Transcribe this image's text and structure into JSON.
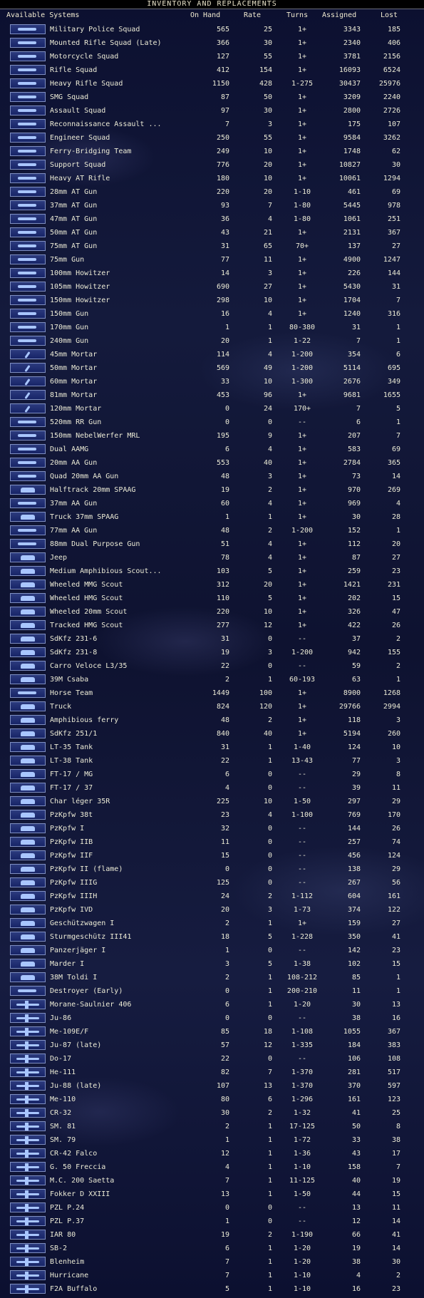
{
  "window": {
    "title": "INVENTORY AND REPLACEMENTS"
  },
  "columns": {
    "name": "Available Systems",
    "on_hand": "On Hand",
    "rate": "Rate",
    "turns": "Turns",
    "assigned": "Assigned",
    "lost": "Lost"
  },
  "systems": [
    {
      "name": "Military Police Squad",
      "on_hand": "565",
      "rate": "25",
      "turns": "1+",
      "assigned": "3343",
      "lost": "185",
      "icon": "infantry-icon"
    },
    {
      "name": "Mounted Rifle Squad (Late)",
      "on_hand": "366",
      "rate": "30",
      "turns": "1+",
      "assigned": "2340",
      "lost": "406",
      "icon": "infantry-icon"
    },
    {
      "name": "Motorcycle Squad",
      "on_hand": "127",
      "rate": "55",
      "turns": "1+",
      "assigned": "3781",
      "lost": "2156",
      "icon": "infantry-icon"
    },
    {
      "name": "Rifle Squad",
      "on_hand": "412",
      "rate": "154",
      "turns": "1+",
      "assigned": "16093",
      "lost": "6524",
      "icon": "infantry-icon"
    },
    {
      "name": "Heavy Rifle Squad",
      "on_hand": "1150",
      "rate": "428",
      "turns": "1-275",
      "assigned": "30437",
      "lost": "25976",
      "icon": "infantry-icon"
    },
    {
      "name": "SMG Squad",
      "on_hand": "87",
      "rate": "50",
      "turns": "1+",
      "assigned": "3209",
      "lost": "2240",
      "icon": "infantry-icon"
    },
    {
      "name": "Assault Squad",
      "on_hand": "97",
      "rate": "30",
      "turns": "1+",
      "assigned": "2800",
      "lost": "2726",
      "icon": "infantry-icon"
    },
    {
      "name": "Reconnaissance Assault ...",
      "on_hand": "7",
      "rate": "3",
      "turns": "1+",
      "assigned": "175",
      "lost": "107",
      "icon": "infantry-icon"
    },
    {
      "name": "Engineer Squad",
      "on_hand": "250",
      "rate": "55",
      "turns": "1+",
      "assigned": "9584",
      "lost": "3262",
      "icon": "infantry-icon"
    },
    {
      "name": "Ferry-Bridging Team",
      "on_hand": "249",
      "rate": "10",
      "turns": "1+",
      "assigned": "1748",
      "lost": "62",
      "icon": "infantry-icon"
    },
    {
      "name": "Support Squad",
      "on_hand": "776",
      "rate": "20",
      "turns": "1+",
      "assigned": "10827",
      "lost": "30",
      "icon": "infantry-icon"
    },
    {
      "name": "Heavy AT Rifle",
      "on_hand": "180",
      "rate": "10",
      "turns": "1+",
      "assigned": "10061",
      "lost": "1294",
      "icon": "gun-icon"
    },
    {
      "name": "28mm AT Gun",
      "on_hand": "220",
      "rate": "20",
      "turns": "1-10",
      "assigned": "461",
      "lost": "69",
      "icon": "gun-icon"
    },
    {
      "name": "37mm AT Gun",
      "on_hand": "93",
      "rate": "7",
      "turns": "1-80",
      "assigned": "5445",
      "lost": "978",
      "icon": "gun-icon"
    },
    {
      "name": "47mm AT Gun",
      "on_hand": "36",
      "rate": "4",
      "turns": "1-80",
      "assigned": "1061",
      "lost": "251",
      "icon": "gun-icon"
    },
    {
      "name": "50mm AT Gun",
      "on_hand": "43",
      "rate": "21",
      "turns": "1+",
      "assigned": "2131",
      "lost": "367",
      "icon": "gun-icon"
    },
    {
      "name": "75mm AT Gun",
      "on_hand": "31",
      "rate": "65",
      "turns": "70+",
      "assigned": "137",
      "lost": "27",
      "icon": "gun-icon"
    },
    {
      "name": "75mm Gun",
      "on_hand": "77",
      "rate": "11",
      "turns": "1+",
      "assigned": "4900",
      "lost": "1247",
      "icon": "gun-icon"
    },
    {
      "name": "100mm Howitzer",
      "on_hand": "14",
      "rate": "3",
      "turns": "1+",
      "assigned": "226",
      "lost": "144",
      "icon": "gun-icon"
    },
    {
      "name": "105mm Howitzer",
      "on_hand": "690",
      "rate": "27",
      "turns": "1+",
      "assigned": "5430",
      "lost": "31",
      "icon": "gun-icon"
    },
    {
      "name": "150mm Howitzer",
      "on_hand": "298",
      "rate": "10",
      "turns": "1+",
      "assigned": "1704",
      "lost": "7",
      "icon": "gun-icon"
    },
    {
      "name": "150mm Gun",
      "on_hand": "16",
      "rate": "4",
      "turns": "1+",
      "assigned": "1240",
      "lost": "316",
      "icon": "gun-icon"
    },
    {
      "name": "170mm Gun",
      "on_hand": "1",
      "rate": "1",
      "turns": "80-380",
      "assigned": "31",
      "lost": "1",
      "icon": "gun-icon"
    },
    {
      "name": "240mm Gun",
      "on_hand": "20",
      "rate": "1",
      "turns": "1-22",
      "assigned": "7",
      "lost": "1",
      "icon": "gun-icon"
    },
    {
      "name": "45mm Mortar",
      "on_hand": "114",
      "rate": "4",
      "turns": "1-200",
      "assigned": "354",
      "lost": "6",
      "icon": "mortar-icon"
    },
    {
      "name": "50mm Mortar",
      "on_hand": "569",
      "rate": "49",
      "turns": "1-200",
      "assigned": "5114",
      "lost": "695",
      "icon": "mortar-icon"
    },
    {
      "name": "60mm Mortar",
      "on_hand": "33",
      "rate": "10",
      "turns": "1-300",
      "assigned": "2676",
      "lost": "349",
      "icon": "mortar-icon"
    },
    {
      "name": "81mm Mortar",
      "on_hand": "453",
      "rate": "96",
      "turns": "1+",
      "assigned": "9681",
      "lost": "1655",
      "icon": "mortar-icon"
    },
    {
      "name": "120mm Mortar",
      "on_hand": "0",
      "rate": "24",
      "turns": "170+",
      "assigned": "7",
      "lost": "5",
      "icon": "mortar-icon"
    },
    {
      "name": "520mm RR Gun",
      "on_hand": "0",
      "rate": "0",
      "turns": "--",
      "assigned": "6",
      "lost": "1",
      "icon": "gun-icon"
    },
    {
      "name": "150mm NebelWerfer MRL",
      "on_hand": "195",
      "rate": "9",
      "turns": "1+",
      "assigned": "207",
      "lost": "7",
      "icon": "gun-icon"
    },
    {
      "name": "Dual AAMG",
      "on_hand": "6",
      "rate": "4",
      "turns": "1+",
      "assigned": "583",
      "lost": "69",
      "icon": "gun-icon"
    },
    {
      "name": "20mm AA Gun",
      "on_hand": "553",
      "rate": "40",
      "turns": "1+",
      "assigned": "2784",
      "lost": "365",
      "icon": "gun-icon"
    },
    {
      "name": "Quad 20mm AA Gun",
      "on_hand": "48",
      "rate": "3",
      "turns": "1+",
      "assigned": "73",
      "lost": "14",
      "icon": "gun-icon"
    },
    {
      "name": "Halftrack 20mm SPAAG",
      "on_hand": "19",
      "rate": "2",
      "turns": "1+",
      "assigned": "970",
      "lost": "269",
      "icon": "vehicle-icon"
    },
    {
      "name": "37mm AA Gun",
      "on_hand": "60",
      "rate": "4",
      "turns": "1+",
      "assigned": "969",
      "lost": "4",
      "icon": "gun-icon"
    },
    {
      "name": "Truck 37mm SPAAG",
      "on_hand": "1",
      "rate": "1",
      "turns": "1+",
      "assigned": "30",
      "lost": "28",
      "icon": "vehicle-icon"
    },
    {
      "name": "77mm AA Gun",
      "on_hand": "48",
      "rate": "2",
      "turns": "1-200",
      "assigned": "152",
      "lost": "1",
      "icon": "gun-icon"
    },
    {
      "name": "88mm Dual Purpose Gun",
      "on_hand": "51",
      "rate": "4",
      "turns": "1+",
      "assigned": "112",
      "lost": "20",
      "icon": "gun-icon"
    },
    {
      "name": "Jeep",
      "on_hand": "78",
      "rate": "4",
      "turns": "1+",
      "assigned": "87",
      "lost": "27",
      "icon": "vehicle-icon"
    },
    {
      "name": "Medium Amphibious Scout...",
      "on_hand": "103",
      "rate": "5",
      "turns": "1+",
      "assigned": "259",
      "lost": "23",
      "icon": "vehicle-icon"
    },
    {
      "name": "Wheeled MMG Scout",
      "on_hand": "312",
      "rate": "20",
      "turns": "1+",
      "assigned": "1421",
      "lost": "231",
      "icon": "vehicle-icon"
    },
    {
      "name": "Wheeled HMG Scout",
      "on_hand": "110",
      "rate": "5",
      "turns": "1+",
      "assigned": "202",
      "lost": "15",
      "icon": "vehicle-icon"
    },
    {
      "name": "Wheeled 20mm Scout",
      "on_hand": "220",
      "rate": "10",
      "turns": "1+",
      "assigned": "326",
      "lost": "47",
      "icon": "vehicle-icon"
    },
    {
      "name": "Tracked HMG Scout",
      "on_hand": "277",
      "rate": "12",
      "turns": "1+",
      "assigned": "422",
      "lost": "26",
      "icon": "vehicle-icon"
    },
    {
      "name": "SdKfz 231-6",
      "on_hand": "31",
      "rate": "0",
      "turns": "--",
      "assigned": "37",
      "lost": "2",
      "icon": "vehicle-icon"
    },
    {
      "name": "SdKfz 231-8",
      "on_hand": "19",
      "rate": "3",
      "turns": "1-200",
      "assigned": "942",
      "lost": "155",
      "icon": "vehicle-icon"
    },
    {
      "name": "Carro Veloce L3/35",
      "on_hand": "22",
      "rate": "0",
      "turns": "--",
      "assigned": "59",
      "lost": "2",
      "icon": "tank-icon"
    },
    {
      "name": "39M Csaba",
      "on_hand": "2",
      "rate": "1",
      "turns": "60-193",
      "assigned": "63",
      "lost": "1",
      "icon": "vehicle-icon"
    },
    {
      "name": "Horse Team",
      "on_hand": "1449",
      "rate": "100",
      "turns": "1+",
      "assigned": "8900",
      "lost": "1268",
      "icon": "horse-icon"
    },
    {
      "name": "Truck",
      "on_hand": "824",
      "rate": "120",
      "turns": "1+",
      "assigned": "29766",
      "lost": "2994",
      "icon": "truck-icon"
    },
    {
      "name": "Amphibious ferry",
      "on_hand": "48",
      "rate": "2",
      "turns": "1+",
      "assigned": "118",
      "lost": "3",
      "icon": "vehicle-icon"
    },
    {
      "name": "SdKfz 251/1",
      "on_hand": "840",
      "rate": "40",
      "turns": "1+",
      "assigned": "5194",
      "lost": "260",
      "icon": "vehicle-icon"
    },
    {
      "name": "LT-35 Tank",
      "on_hand": "31",
      "rate": "1",
      "turns": "1-40",
      "assigned": "124",
      "lost": "10",
      "icon": "tank-icon"
    },
    {
      "name": "LT-38 Tank",
      "on_hand": "22",
      "rate": "1",
      "turns": "13-43",
      "assigned": "77",
      "lost": "3",
      "icon": "tank-icon"
    },
    {
      "name": "FT-17 / MG",
      "on_hand": "6",
      "rate": "0",
      "turns": "--",
      "assigned": "29",
      "lost": "8",
      "icon": "tank-icon"
    },
    {
      "name": "FT-17 / 37",
      "on_hand": "4",
      "rate": "0",
      "turns": "--",
      "assigned": "39",
      "lost": "11",
      "icon": "tank-icon"
    },
    {
      "name": "Char léger 35R",
      "on_hand": "225",
      "rate": "10",
      "turns": "1-50",
      "assigned": "297",
      "lost": "29",
      "icon": "tank-icon"
    },
    {
      "name": "PzKpfw 38t",
      "on_hand": "23",
      "rate": "4",
      "turns": "1-100",
      "assigned": "769",
      "lost": "170",
      "icon": "tank-icon"
    },
    {
      "name": "PzKpfw I",
      "on_hand": "32",
      "rate": "0",
      "turns": "--",
      "assigned": "144",
      "lost": "26",
      "icon": "tank-icon"
    },
    {
      "name": "PzKpfw IIB",
      "on_hand": "11",
      "rate": "0",
      "turns": "--",
      "assigned": "257",
      "lost": "74",
      "icon": "tank-icon"
    },
    {
      "name": "PzKpfw IIF",
      "on_hand": "15",
      "rate": "0",
      "turns": "--",
      "assigned": "456",
      "lost": "124",
      "icon": "tank-icon"
    },
    {
      "name": "PzKpfw II (flame)",
      "on_hand": "0",
      "rate": "0",
      "turns": "--",
      "assigned": "138",
      "lost": "29",
      "icon": "tank-icon"
    },
    {
      "name": "PzKpfw IIIG",
      "on_hand": "125",
      "rate": "0",
      "turns": "--",
      "assigned": "267",
      "lost": "56",
      "icon": "tank-icon"
    },
    {
      "name": "PzKpfw IIIH",
      "on_hand": "24",
      "rate": "2",
      "turns": "1-112",
      "assigned": "604",
      "lost": "161",
      "icon": "tank-icon"
    },
    {
      "name": "PzKpfw IVD",
      "on_hand": "20",
      "rate": "3",
      "turns": "1-73",
      "assigned": "374",
      "lost": "122",
      "icon": "tank-icon"
    },
    {
      "name": "Geschützwagen I",
      "on_hand": "2",
      "rate": "1",
      "turns": "1+",
      "assigned": "159",
      "lost": "27",
      "icon": "tank-icon"
    },
    {
      "name": "Sturmgeschütz III41",
      "on_hand": "18",
      "rate": "5",
      "turns": "1-228",
      "assigned": "350",
      "lost": "41",
      "icon": "tank-icon"
    },
    {
      "name": "Panzerjäger I",
      "on_hand": "1",
      "rate": "0",
      "turns": "--",
      "assigned": "142",
      "lost": "23",
      "icon": "tank-icon"
    },
    {
      "name": "Marder I",
      "on_hand": "3",
      "rate": "5",
      "turns": "1-38",
      "assigned": "102",
      "lost": "15",
      "icon": "tank-icon"
    },
    {
      "name": "38M Toldi I",
      "on_hand": "2",
      "rate": "1",
      "turns": "108-212",
      "assigned": "85",
      "lost": "1",
      "icon": "tank-icon"
    },
    {
      "name": "Destroyer (Early)",
      "on_hand": "0",
      "rate": "1",
      "turns": "200-210",
      "assigned": "11",
      "lost": "1",
      "icon": "ship-icon"
    },
    {
      "name": "Morane-Saulnier 406",
      "on_hand": "6",
      "rate": "1",
      "turns": "1-20",
      "assigned": "30",
      "lost": "13",
      "icon": "plane-icon"
    },
    {
      "name": "Ju-86",
      "on_hand": "0",
      "rate": "0",
      "turns": "--",
      "assigned": "38",
      "lost": "16",
      "icon": "plane-icon"
    },
    {
      "name": "Me-109E/F",
      "on_hand": "85",
      "rate": "18",
      "turns": "1-108",
      "assigned": "1055",
      "lost": "367",
      "icon": "plane-icon"
    },
    {
      "name": "Ju-87 (late)",
      "on_hand": "57",
      "rate": "12",
      "turns": "1-335",
      "assigned": "184",
      "lost": "383",
      "icon": "plane-icon"
    },
    {
      "name": "Do-17",
      "on_hand": "22",
      "rate": "0",
      "turns": "--",
      "assigned": "106",
      "lost": "108",
      "icon": "plane-icon"
    },
    {
      "name": "He-111",
      "on_hand": "82",
      "rate": "7",
      "turns": "1-370",
      "assigned": "281",
      "lost": "517",
      "icon": "plane-icon"
    },
    {
      "name": "Ju-88 (late)",
      "on_hand": "107",
      "rate": "13",
      "turns": "1-370",
      "assigned": "370",
      "lost": "597",
      "icon": "plane-icon"
    },
    {
      "name": "Me-110",
      "on_hand": "80",
      "rate": "6",
      "turns": "1-296",
      "assigned": "161",
      "lost": "123",
      "icon": "plane-icon"
    },
    {
      "name": "CR-32",
      "on_hand": "30",
      "rate": "2",
      "turns": "1-32",
      "assigned": "41",
      "lost": "25",
      "icon": "plane-icon"
    },
    {
      "name": "SM. 81",
      "on_hand": "2",
      "rate": "1",
      "turns": "17-125",
      "assigned": "50",
      "lost": "8",
      "icon": "plane-icon"
    },
    {
      "name": "SM. 79",
      "on_hand": "1",
      "rate": "1",
      "turns": "1-72",
      "assigned": "33",
      "lost": "38",
      "icon": "plane-icon"
    },
    {
      "name": "CR-42 Falco",
      "on_hand": "12",
      "rate": "1",
      "turns": "1-36",
      "assigned": "43",
      "lost": "17",
      "icon": "plane-icon"
    },
    {
      "name": "G. 50 Freccia",
      "on_hand": "4",
      "rate": "1",
      "turns": "1-10",
      "assigned": "158",
      "lost": "7",
      "icon": "plane-icon"
    },
    {
      "name": "M.C. 200 Saetta",
      "on_hand": "7",
      "rate": "1",
      "turns": "11-125",
      "assigned": "40",
      "lost": "19",
      "icon": "plane-icon"
    },
    {
      "name": "Fokker D XXIII",
      "on_hand": "13",
      "rate": "1",
      "turns": "1-50",
      "assigned": "44",
      "lost": "15",
      "icon": "plane-icon"
    },
    {
      "name": "PZL P.24",
      "on_hand": "0",
      "rate": "0",
      "turns": "--",
      "assigned": "13",
      "lost": "11",
      "icon": "plane-icon"
    },
    {
      "name": "PZL P.37",
      "on_hand": "1",
      "rate": "0",
      "turns": "--",
      "assigned": "12",
      "lost": "14",
      "icon": "plane-icon"
    },
    {
      "name": "IAR 80",
      "on_hand": "19",
      "rate": "2",
      "turns": "1-190",
      "assigned": "66",
      "lost": "41",
      "icon": "plane-icon"
    },
    {
      "name": "SB-2",
      "on_hand": "6",
      "rate": "1",
      "turns": "1-20",
      "assigned": "19",
      "lost": "14",
      "icon": "plane-icon"
    },
    {
      "name": "Blenheim",
      "on_hand": "7",
      "rate": "1",
      "turns": "1-20",
      "assigned": "38",
      "lost": "30",
      "icon": "plane-icon"
    },
    {
      "name": "Hurricane",
      "on_hand": "7",
      "rate": "1",
      "turns": "1-10",
      "assigned": "4",
      "lost": "2",
      "icon": "plane-icon"
    },
    {
      "name": "F2A Buffalo",
      "on_hand": "5",
      "rate": "1",
      "turns": "1-10",
      "assigned": "16",
      "lost": "23",
      "icon": "plane-icon"
    }
  ]
}
